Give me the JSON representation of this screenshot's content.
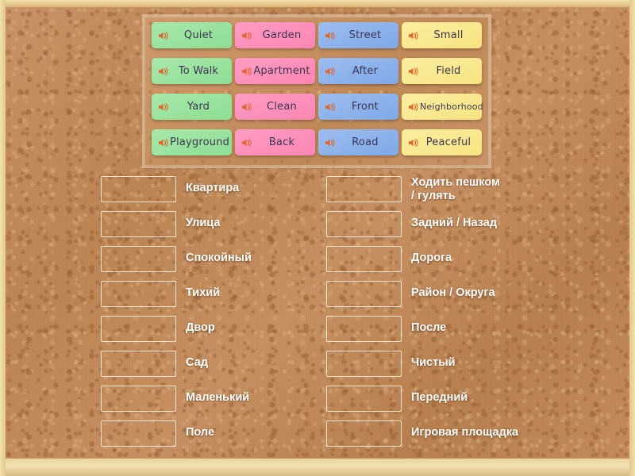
{
  "app": {
    "type": "match-up-word-game",
    "board_background": "cork",
    "frame_color": "#eed79f"
  },
  "tray": {
    "name": "word-tiles-tray",
    "columns": 4,
    "rows": 4,
    "icon": "speaker-icon",
    "colors": {
      "green": "#8ddd95",
      "pink": "#fb85b4",
      "blue": "#7ea8e6",
      "yellow": "#f6e382",
      "text": "#3c3450"
    },
    "tiles": [
      {
        "label": "Quiet",
        "color": "green",
        "col": 0,
        "row": 0
      },
      {
        "label": "Garden",
        "color": "pink",
        "col": 1,
        "row": 0
      },
      {
        "label": "Street",
        "color": "blue",
        "col": 2,
        "row": 0
      },
      {
        "label": "Small",
        "color": "yellow",
        "col": 3,
        "row": 0
      },
      {
        "label": "To Walk",
        "color": "green",
        "col": 0,
        "row": 1
      },
      {
        "label": "Apartment",
        "color": "pink",
        "col": 1,
        "row": 1
      },
      {
        "label": "After",
        "color": "blue",
        "col": 2,
        "row": 1
      },
      {
        "label": "Field",
        "color": "yellow",
        "col": 3,
        "row": 1
      },
      {
        "label": "Yard",
        "color": "green",
        "col": 0,
        "row": 2
      },
      {
        "label": "Clean",
        "color": "pink",
        "col": 1,
        "row": 2
      },
      {
        "label": "Front",
        "color": "blue",
        "col": 2,
        "row": 2
      },
      {
        "label": "Neighborhood",
        "color": "yellow",
        "col": 3,
        "row": 2,
        "small": true
      },
      {
        "label": "Playground",
        "color": "green",
        "col": 0,
        "row": 3,
        "small": false
      },
      {
        "label": "Back",
        "color": "pink",
        "col": 1,
        "row": 3
      },
      {
        "label": "Road",
        "color": "blue",
        "col": 2,
        "row": 3
      },
      {
        "label": "Peaceful",
        "color": "yellow",
        "col": 3,
        "row": 3
      }
    ]
  },
  "answers": {
    "name": "answer-slots",
    "left_column": [
      {
        "label": "Квартира",
        "value": ""
      },
      {
        "label": "Улица",
        "value": ""
      },
      {
        "label": "Спокойный",
        "value": ""
      },
      {
        "label": "Тихий",
        "value": ""
      },
      {
        "label": "Двор",
        "value": ""
      },
      {
        "label": "Сад",
        "value": ""
      },
      {
        "label": "Маленький",
        "value": ""
      },
      {
        "label": "Поле",
        "value": ""
      }
    ],
    "right_column": [
      {
        "label": "Ходить пешком\n/ гулять",
        "value": "",
        "two_line": true
      },
      {
        "label": "Задний / Назад",
        "value": ""
      },
      {
        "label": "Дорога",
        "value": ""
      },
      {
        "label": "Район / Округа",
        "value": ""
      },
      {
        "label": "После",
        "value": ""
      },
      {
        "label": "Чистый",
        "value": ""
      },
      {
        "label": "Передний",
        "value": ""
      },
      {
        "label": "Игровая площадка",
        "value": ""
      }
    ]
  }
}
